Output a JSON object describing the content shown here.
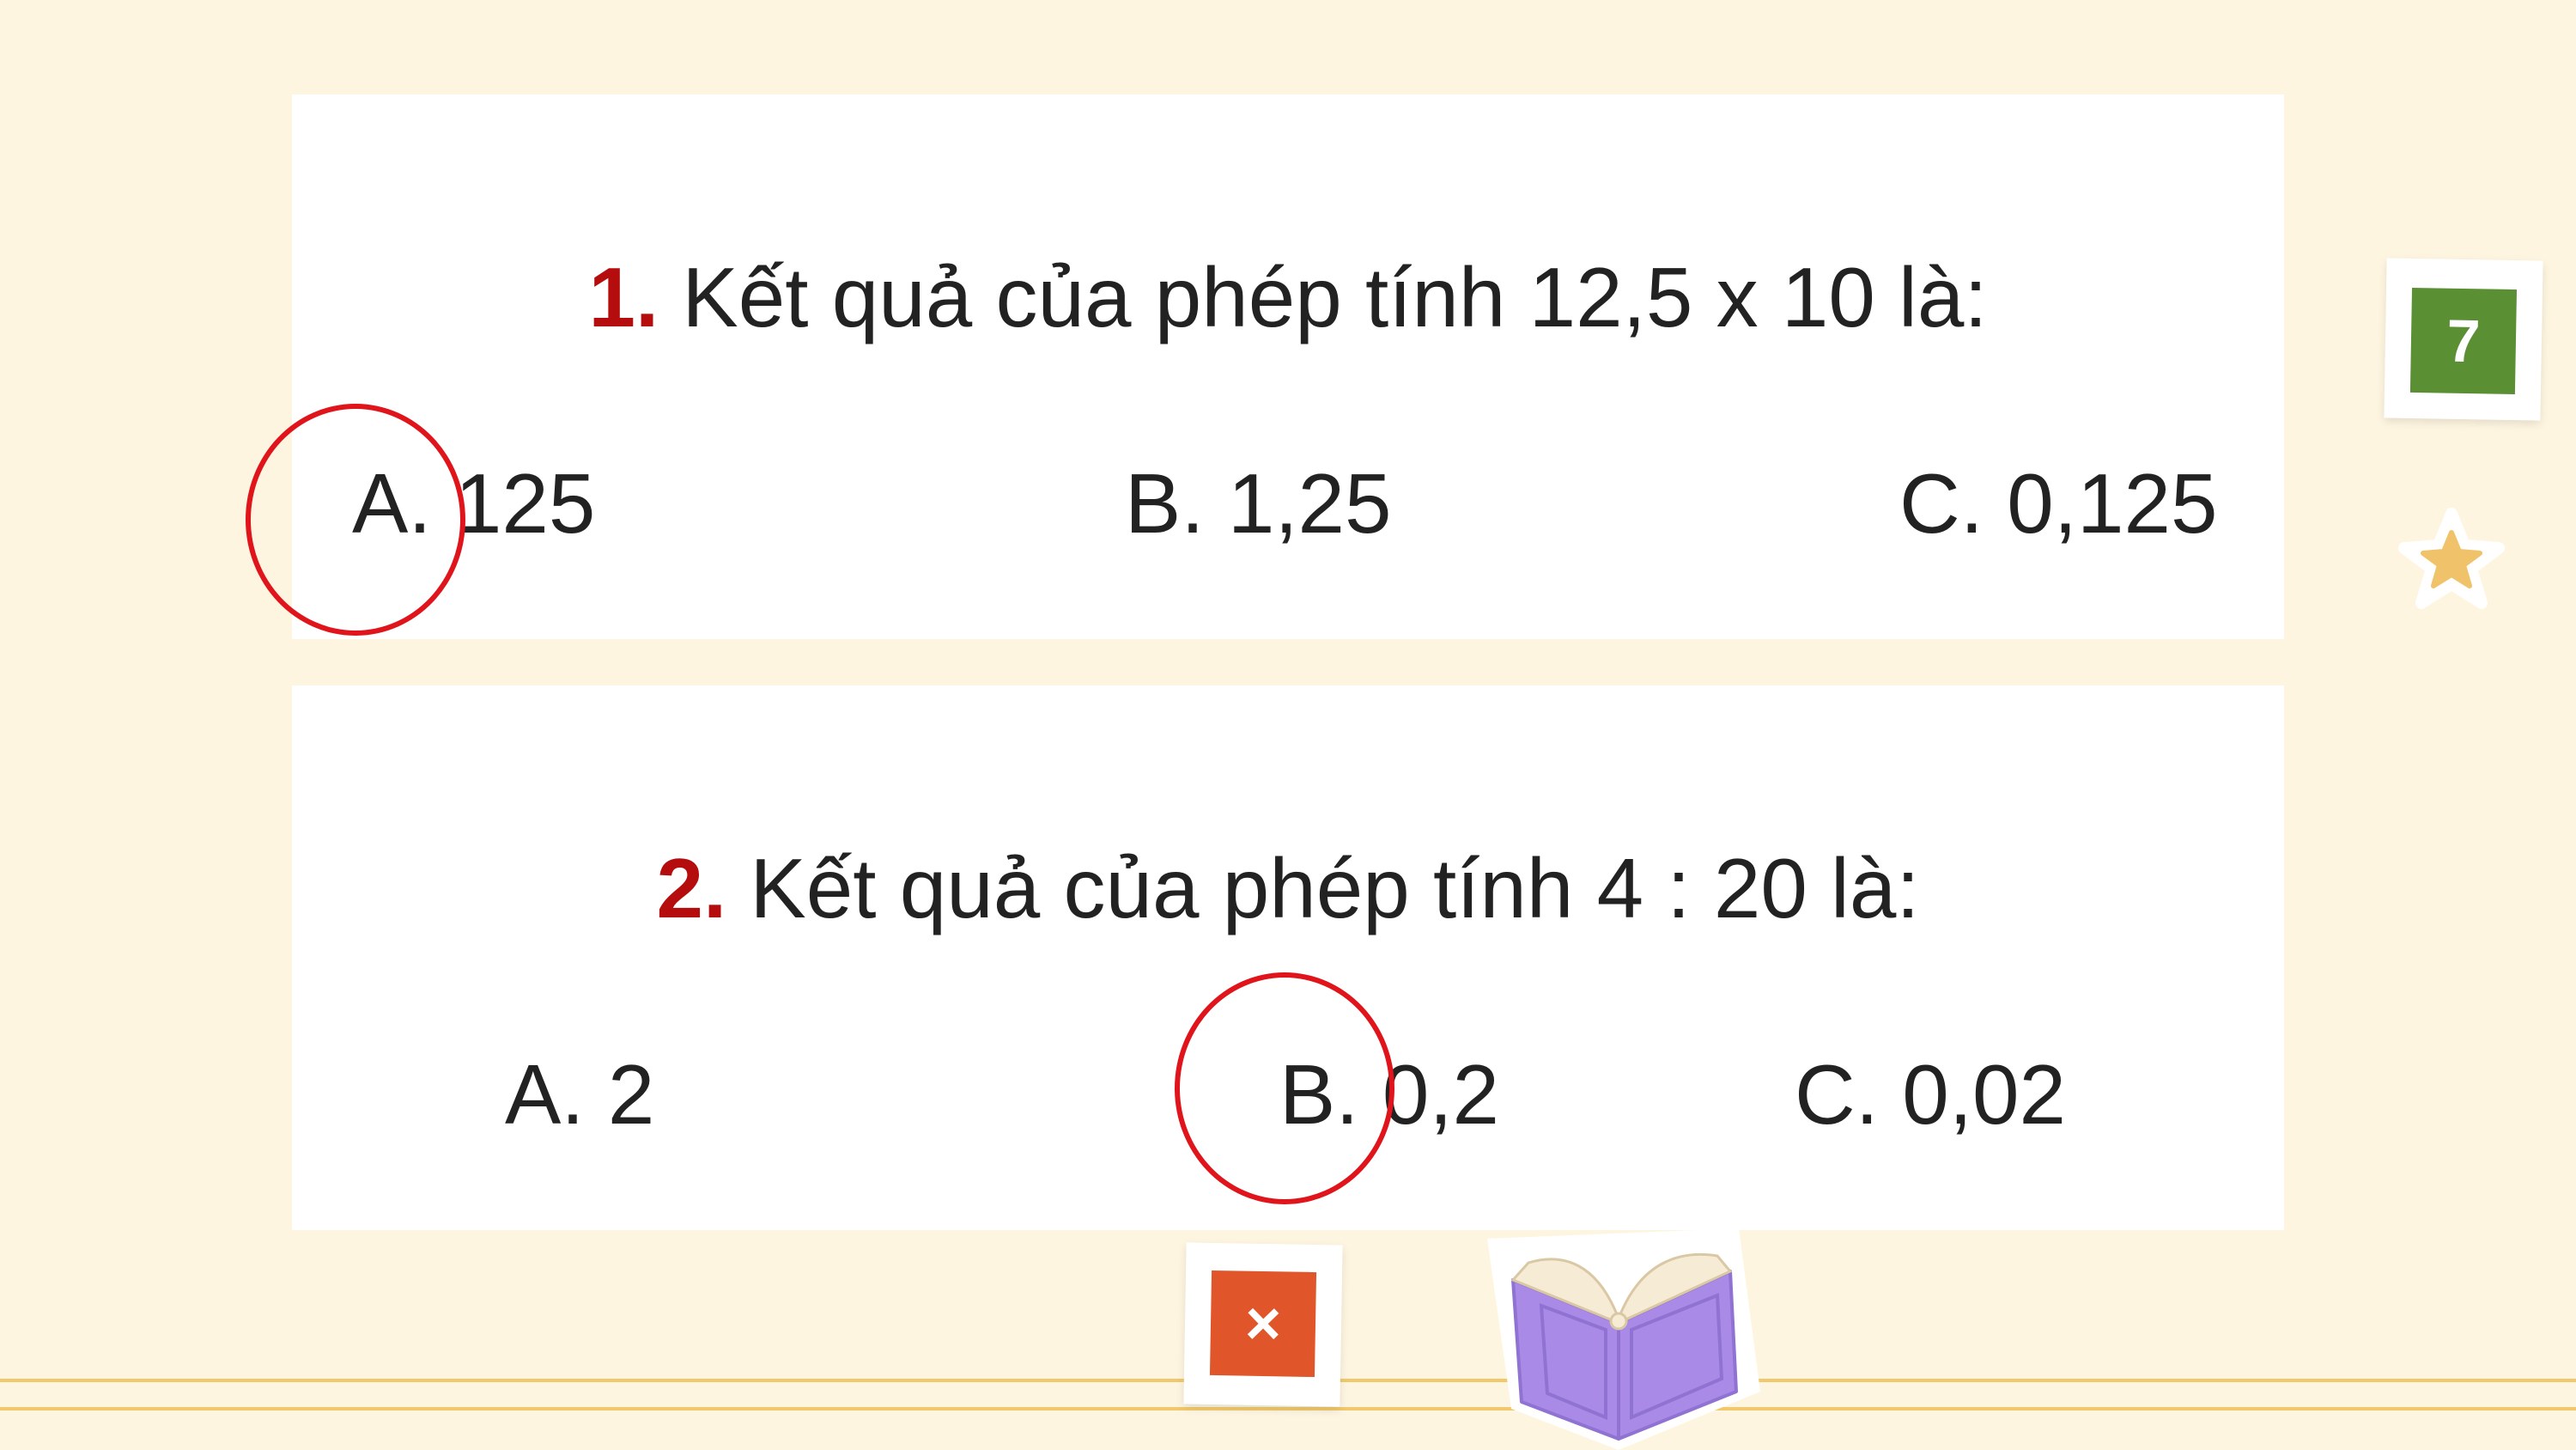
{
  "questions": [
    {
      "number": "1.",
      "text": "Kết quả của phép tính 12,5 x 10 là:",
      "options": [
        "A. 125",
        "B. 1,25",
        "C. 0,125"
      ],
      "circled_option": "A"
    },
    {
      "number": "2.",
      "text": "Kết quả của phép tính 4 : 20 là:",
      "options": [
        "A. 2",
        "B. 0,2",
        "C. 0,02"
      ],
      "circled_option": "B"
    }
  ],
  "page_badge": {
    "label": "7",
    "color": "#5a8f33"
  },
  "close_badge": {
    "label": "×",
    "color": "#e0562a"
  },
  "colors": {
    "background": "#fdf5df",
    "question_number": "#b50d0d",
    "circle": "#e0141b",
    "rule": "#f1c96c",
    "book": "#a98ae6",
    "star": "#f0c26a"
  },
  "icons": [
    "star-icon",
    "open-book-icon",
    "close-icon"
  ]
}
